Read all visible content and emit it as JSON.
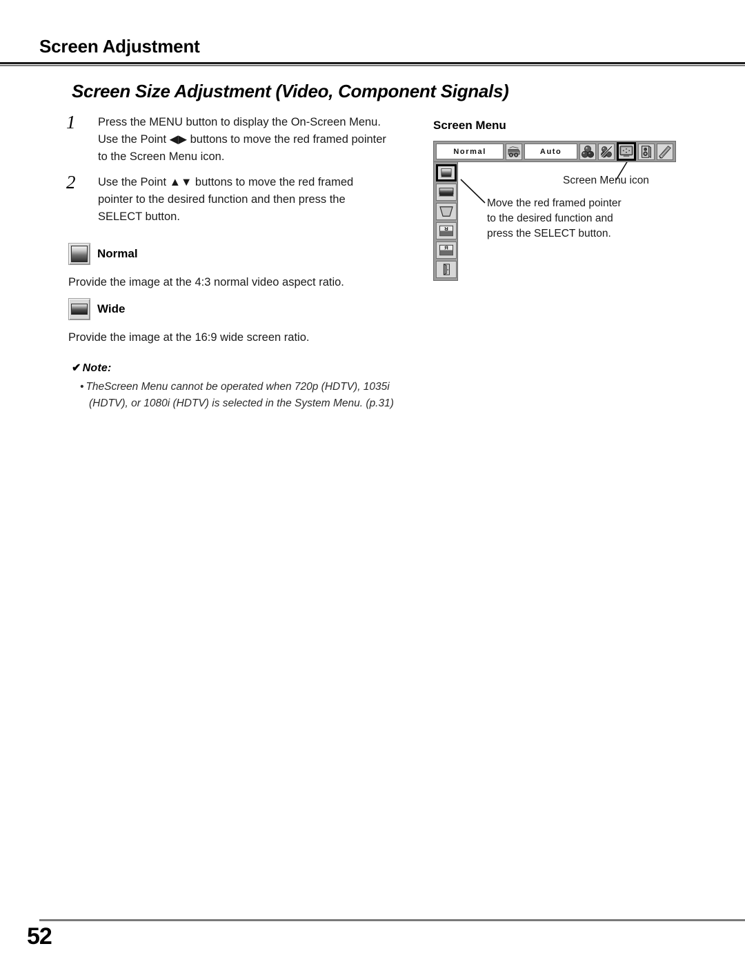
{
  "header": {
    "running_title": "Screen Adjustment"
  },
  "section": {
    "title": "Screen Size Adjustment (Video, Component Signals)"
  },
  "steps": [
    {
      "number": "1",
      "text": "Press the MENU button to display the On-Screen Menu. Use the Point ◀▶ buttons to move the red framed pointer to the Screen Menu icon."
    },
    {
      "number": "2",
      "text": "Use the Point ▲▼ buttons to move the red framed pointer to the desired function and then press the SELECT button."
    }
  ],
  "modes": [
    {
      "label": "Normal",
      "description": "Provide the image at the 4:3 normal video aspect ratio.",
      "icon": "normal-screen-icon"
    },
    {
      "label": "Wide",
      "description": "Provide the image at the 16:9 wide screen ratio.",
      "icon": "wide-screen-icon"
    }
  ],
  "note": {
    "tick": "✔",
    "heading": "Note:",
    "bullet": "•",
    "line1": "TheScreen Menu cannot be operated when 720p (HDTV), 1035i",
    "line2": "(HDTV), or 1080i (HDTV) is selected in the System Menu. (p.31)"
  },
  "figure": {
    "title": "Screen Menu",
    "osd_bar": {
      "field_screen_value": "Normal",
      "field_auto_value": "Auto",
      "icons": [
        {
          "name": "input-source-icon",
          "selected": false
        },
        {
          "name": "color-adjust-icon",
          "selected": false
        },
        {
          "name": "image-select-icon",
          "selected": false
        },
        {
          "name": "screen-menu-icon",
          "selected": true
        },
        {
          "name": "sound-menu-icon",
          "selected": false
        },
        {
          "name": "setting-menu-icon",
          "selected": false
        }
      ]
    },
    "osd_column": [
      {
        "name": "normal-screen-item",
        "selected": true
      },
      {
        "name": "wide-screen-item",
        "selected": false
      },
      {
        "name": "keystone-item",
        "selected": false
      },
      {
        "name": "ceiling-item",
        "selected": false
      },
      {
        "name": "rear-item",
        "selected": false
      },
      {
        "name": "reset-quit-item",
        "selected": false
      }
    ],
    "annotations": {
      "screen_menu_icon": "Screen Menu icon",
      "move_pointer_line1": "Move the red framed pointer",
      "move_pointer_line2": "to the desired function and",
      "move_pointer_line3": "press the SELECT button."
    }
  },
  "footer": {
    "page_number": "52"
  },
  "colors": {
    "rule_dark": "#1a1a1a",
    "rule_gray": "#7a7a7a",
    "osd_gray": "#9b9b9b",
    "osd_icon_bg": "#d7d7d7",
    "selection_border": "#000000"
  }
}
